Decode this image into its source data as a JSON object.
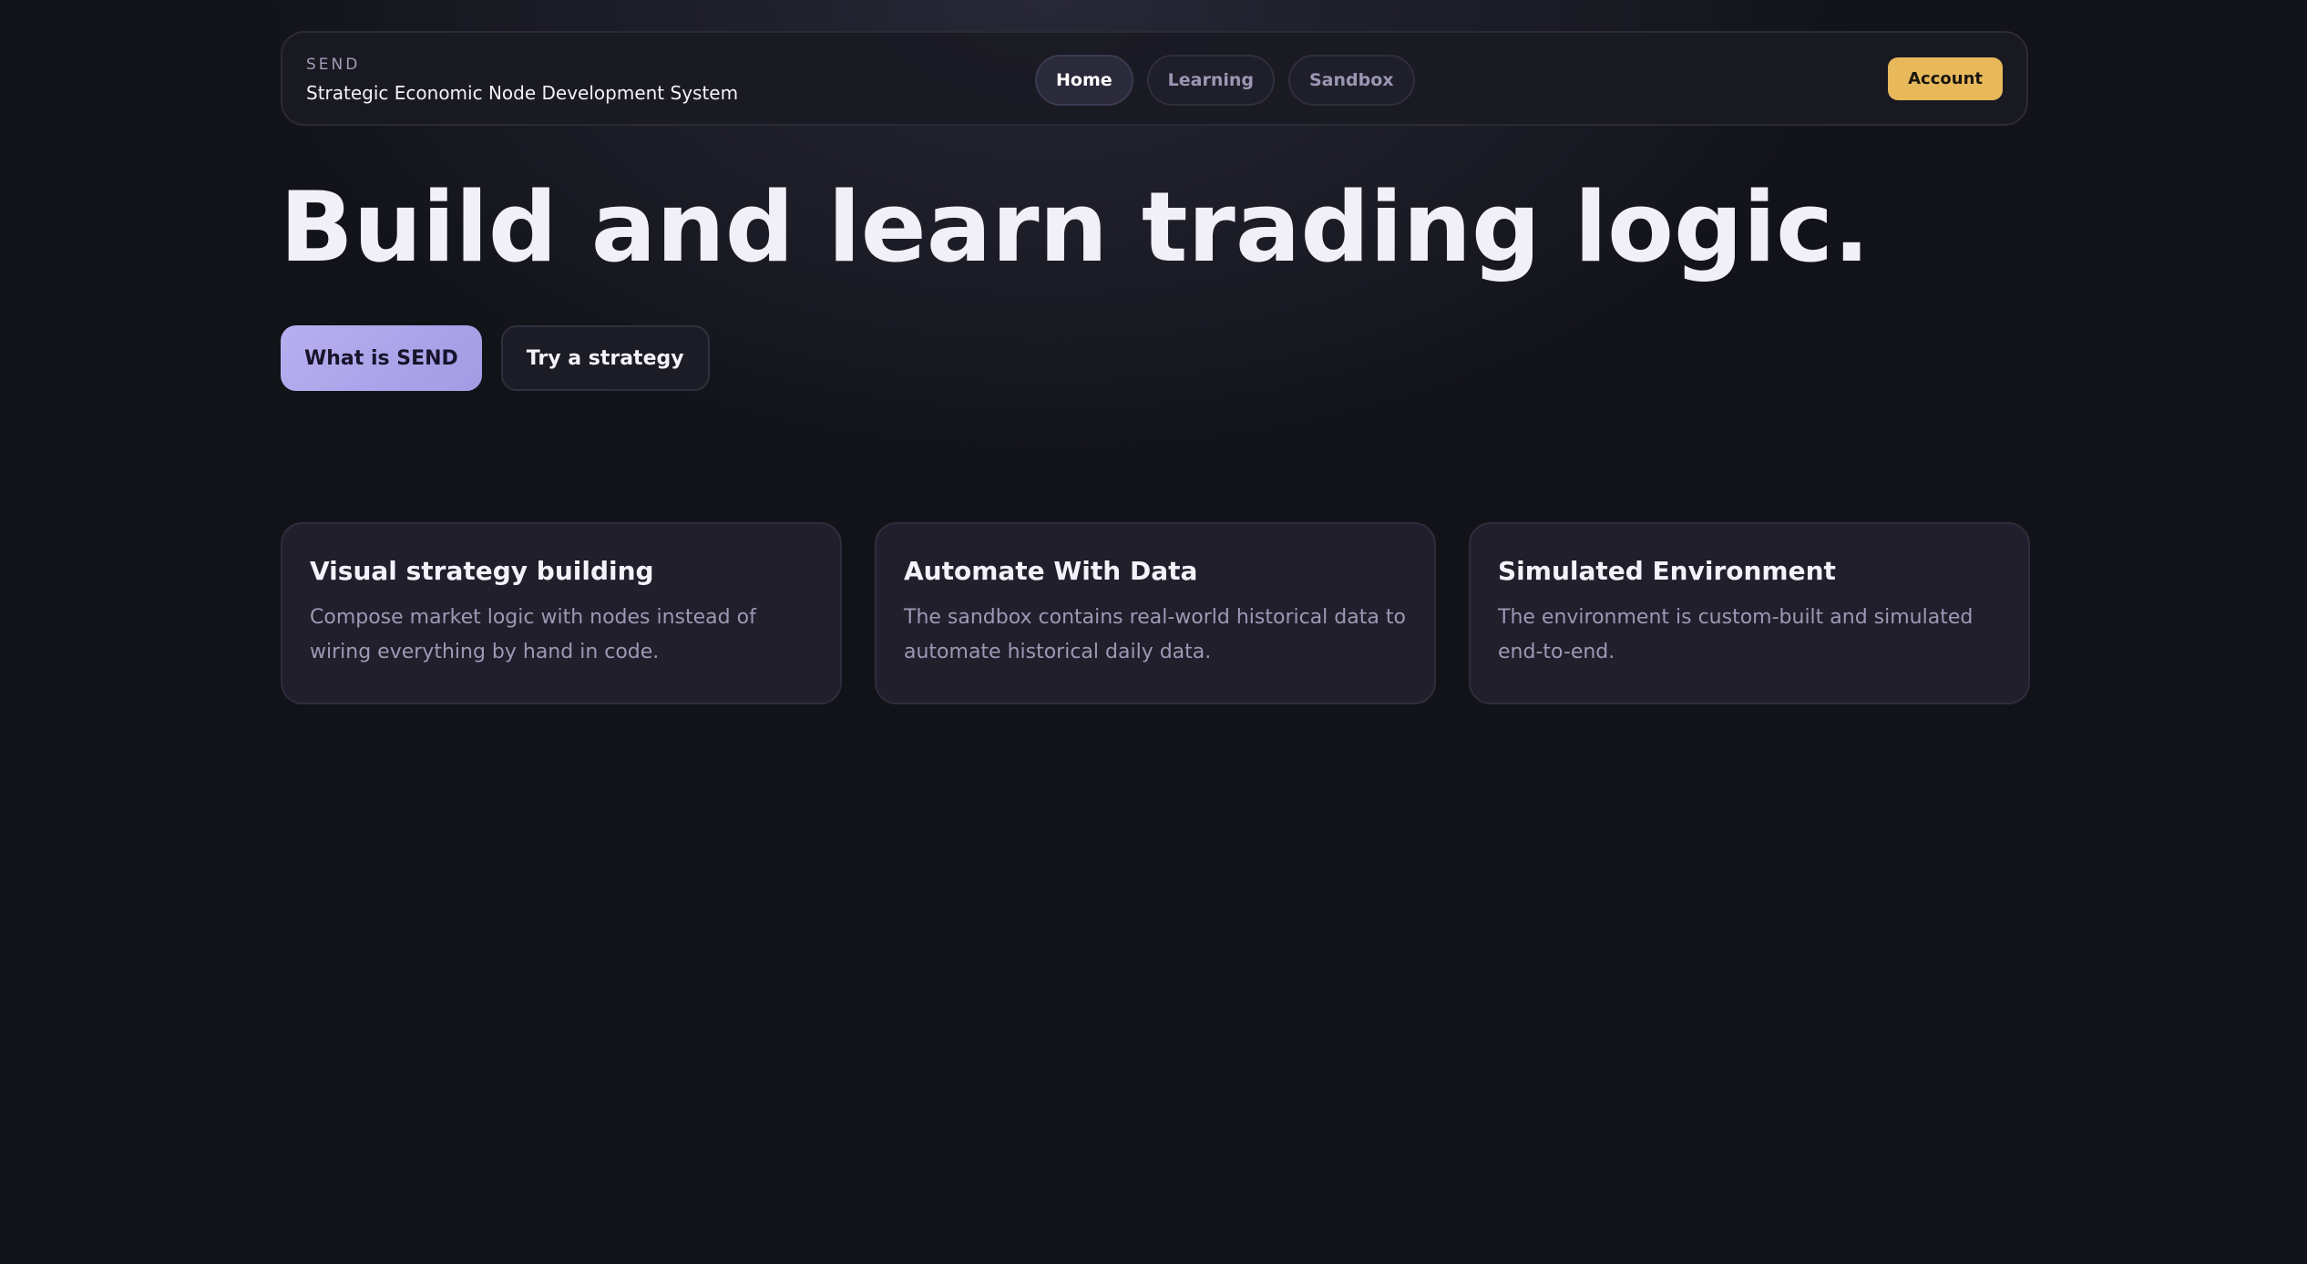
{
  "header": {
    "brand_kicker": "SEND",
    "brand_name": "Strategic Economic Node Development System",
    "nav": [
      {
        "label": "Home",
        "active": true
      },
      {
        "label": "Learning",
        "active": false
      },
      {
        "label": "Sandbox",
        "active": false
      }
    ],
    "account_label": "Account"
  },
  "hero": {
    "title": "Build and learn trading logic.",
    "primary_cta": "What is SEND",
    "secondary_cta": "Try a strategy"
  },
  "features": [
    {
      "title": "Visual strategy building",
      "text": "Compose market logic with nodes instead of wiring everything by hand in code."
    },
    {
      "title": "Automate With Data",
      "text": "The sandbox contains real-world historical data to automate historical daily data."
    },
    {
      "title": "Simulated Environment",
      "text": "The environment is custom-built and simulated end-to-end."
    }
  ],
  "colors": {
    "background": "#121319",
    "accent_primary": "#b7afef",
    "accent_account": "#e8b95a",
    "card_background": "#201f2b"
  }
}
